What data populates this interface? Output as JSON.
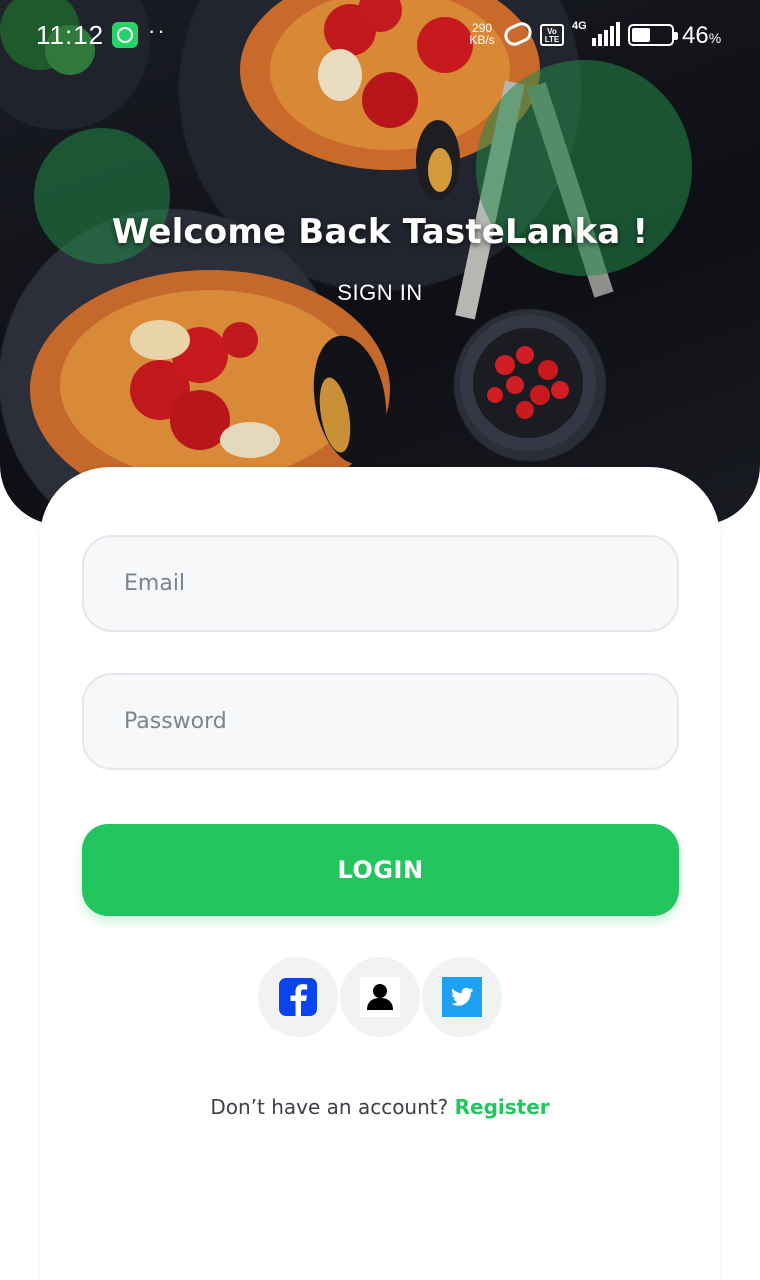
{
  "status_bar": {
    "time": "11:12",
    "dots": "··",
    "net_speed_value": "290",
    "net_speed_unit": "KB/s",
    "volte": "Vo LTE",
    "network": "4G",
    "battery": "46",
    "battery_unit": "%"
  },
  "hero": {
    "title": "Welcome Back TasteLanka !",
    "subtitle": "SIGN IN"
  },
  "form": {
    "email_placeholder": "Email",
    "password_placeholder": "Password",
    "login_label": "LOGIN"
  },
  "social": {
    "facebook_icon": "facebook-icon",
    "guest_icon": "user-icon",
    "twitter_icon": "twitter-icon"
  },
  "register": {
    "prompt": "Don’t have an account?",
    "link": "Register"
  },
  "colors": {
    "accent": "#22c55e",
    "facebook": "#0a44f0",
    "twitter": "#1da1f2"
  }
}
